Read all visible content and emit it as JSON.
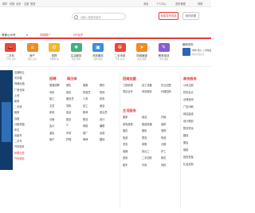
{
  "topbar": {
    "left": [
      "城市",
      "切换",
      "北京",
      "注册",
      "登录"
    ],
    "right": [
      "消息",
      "个人中心",
      "发布管理",
      "帮助"
    ]
  },
  "search": {
    "placeholder": "请输入搜索关键词"
  },
  "header": {
    "publish_label": "免费发布信息",
    "cart_label": "我的收藏"
  },
  "navbar": {
    "city": "首都公众号",
    "items": [
      "同城推广",
      "VIP会员"
    ]
  },
  "categories": [
    {
      "label": "二手车",
      "sub": "二手车 买车",
      "color": "#e8483b",
      "icon": "car-icon",
      "glyph": "🚗"
    },
    {
      "label": "房产",
      "sub": "租房 卖房",
      "color": "#f08a24",
      "icon": "house-icon",
      "glyph": "⌂"
    },
    {
      "label": "宠物",
      "sub": "宠物狗 猫",
      "color": "#f3b72a",
      "icon": "pet-icon",
      "glyph": "✿"
    },
    {
      "label": "生活服务",
      "sub": "家政 维修",
      "color": "#3fb27f",
      "icon": "service-icon",
      "glyph": "✚"
    },
    {
      "label": "商务服务",
      "sub": "装修 搬家",
      "color": "#3b8de0",
      "icon": "briefcase-icon",
      "glyph": "▣"
    },
    {
      "label": "二手市场",
      "sub": "手机 家具",
      "color": "#e8483b",
      "icon": "market-icon",
      "glyph": "♻"
    },
    {
      "label": "同城速递",
      "sub": "快递 跑腿",
      "color": "#f08a24",
      "icon": "delivery-icon",
      "glyph": "➤"
    },
    {
      "label": "教育培训",
      "sub": "学历 技能",
      "color": "#8a5cd1",
      "icon": "education-icon",
      "glyph": "✎"
    }
  ],
  "right_banner": {
    "title": "最新发布",
    "text": "求购 低价 二手物品",
    "sub": "城市生活信息"
  },
  "left_col": {
    "rows": [
      "店铺转让",
      "写字楼",
      "商铺出租",
      "厂房仓库",
      "土地",
      "新房",
      "二手房",
      "租房",
      "合租",
      "日租短租",
      "车位",
      "出租车",
      "二手车",
      "汽车配件"
    ],
    "links": [
      "房屋出售",
      "汽车服务"
    ]
  },
  "sections": {
    "jobs": {
      "title": "招聘",
      "subtitle": "简历库",
      "items": [
        "普通招聘",
        "销售",
        "客服",
        "餐饮",
        "司机",
        "保安",
        "快递员",
        "厨师",
        "普工",
        "服务员",
        "人事",
        "财务",
        "文员",
        "导购",
        "技工",
        "美容",
        "家政",
        "保洁",
        "教师",
        "营业员",
        "仓管",
        "配送",
        "物流",
        "设计",
        "会计",
        "IT",
        "网络",
        "编辑",
        "酒店",
        "市场",
        "推广",
        "运营",
        "医疗",
        "护理",
        "律师",
        "翻译"
      ]
    },
    "business": {
      "title": "招商加盟",
      "items": [
        "工程机械",
        "加工设备",
        "农业加盟",
        "项目合作",
        "商务服务",
        "代理招商"
      ]
    },
    "life": {
      "title": "生活服务",
      "items": [
        "搬家",
        "保洁",
        "开锁",
        "家电维修",
        "管道疏通",
        "装修",
        "婚庆",
        "摄影",
        "宠物",
        "旅游",
        "票务",
        "快递",
        "洗衣",
        "家教",
        "月嫂",
        "保姆",
        "钟点工",
        "护工",
        "回收",
        "二手回收",
        "鲜花",
        "租车",
        "代驾",
        "驾校"
      ]
    },
    "shop": {
      "title": "商务服务",
      "items": [
        "公司注册",
        "财务会计",
        "法律咨询",
        "广告印刷",
        "网站建设",
        "设计策划",
        "物流货运",
        "翻译",
        "展会",
        "保险",
        "投资担保",
        "礼品定制"
      ]
    }
  },
  "colors": {
    "accent": "#e43a3a",
    "ad_bg": "#123a6b"
  }
}
